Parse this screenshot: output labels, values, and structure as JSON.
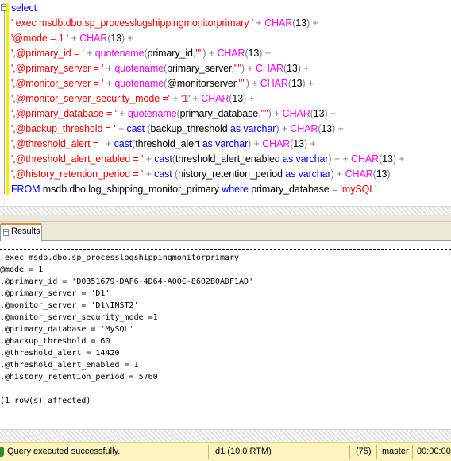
{
  "editor": {
    "lines": [
      {
        "tokens": [
          {
            "c": "kw",
            "t": "select"
          }
        ]
      },
      {
        "tokens": [
          {
            "c": "str",
            "t": "' exec msdb.dbo.sp_processlogshippingmonitorprimary '"
          },
          {
            "c": "op",
            "t": " + "
          },
          {
            "c": "fn",
            "t": "CHAR"
          },
          {
            "c": "op",
            "t": "("
          },
          {
            "c": "tx",
            "t": "13"
          },
          {
            "c": "op",
            "t": ") +"
          }
        ]
      },
      {
        "tokens": [
          {
            "c": "str",
            "t": "'@mode = 1 '"
          },
          {
            "c": "op",
            "t": " + "
          },
          {
            "c": "fn",
            "t": "CHAR"
          },
          {
            "c": "op",
            "t": "("
          },
          {
            "c": "tx",
            "t": "13"
          },
          {
            "c": "op",
            "t": ") +"
          }
        ]
      },
      {
        "tokens": [
          {
            "c": "str",
            "t": "',@primary_id = '"
          },
          {
            "c": "op",
            "t": " + "
          },
          {
            "c": "fn",
            "t": "quotename"
          },
          {
            "c": "op",
            "t": "("
          },
          {
            "c": "tx",
            "t": "primary_id"
          },
          {
            "c": "op",
            "t": ","
          },
          {
            "c": "str",
            "t": "''''"
          },
          {
            "c": "op",
            "t": ") + "
          },
          {
            "c": "fn",
            "t": "CHAR"
          },
          {
            "c": "op",
            "t": "("
          },
          {
            "c": "tx",
            "t": "13"
          },
          {
            "c": "op",
            "t": ") +"
          }
        ]
      },
      {
        "tokens": [
          {
            "c": "str",
            "t": "',@primary_server = '"
          },
          {
            "c": "op",
            "t": " + "
          },
          {
            "c": "fn",
            "t": "quotename"
          },
          {
            "c": "op",
            "t": "("
          },
          {
            "c": "tx",
            "t": "primary_server"
          },
          {
            "c": "op",
            "t": ","
          },
          {
            "c": "str",
            "t": "''''"
          },
          {
            "c": "op",
            "t": ") + "
          },
          {
            "c": "fn",
            "t": "CHAR"
          },
          {
            "c": "op",
            "t": "("
          },
          {
            "c": "tx",
            "t": "13"
          },
          {
            "c": "op",
            "t": ") +"
          }
        ]
      },
      {
        "tokens": [
          {
            "c": "str",
            "t": "',@monitor_server = '"
          },
          {
            "c": "op",
            "t": " + "
          },
          {
            "c": "fn",
            "t": "quotename"
          },
          {
            "c": "op",
            "t": "("
          },
          {
            "c": "tx",
            "t": "@monitorserver"
          },
          {
            "c": "op",
            "t": ","
          },
          {
            "c": "str",
            "t": "''''"
          },
          {
            "c": "op",
            "t": ") + "
          },
          {
            "c": "fn",
            "t": "CHAR"
          },
          {
            "c": "op",
            "t": "("
          },
          {
            "c": "tx",
            "t": "13"
          },
          {
            "c": "op",
            "t": ") +"
          }
        ]
      },
      {
        "tokens": [
          {
            "c": "str",
            "t": "',@monitor_server_security_mode ='"
          },
          {
            "c": "op",
            "t": " + "
          },
          {
            "c": "str",
            "t": "'1'"
          },
          {
            "c": "op",
            "t": " + "
          },
          {
            "c": "fn",
            "t": "CHAR"
          },
          {
            "c": "op",
            "t": "("
          },
          {
            "c": "tx",
            "t": "13"
          },
          {
            "c": "op",
            "t": ") +"
          }
        ]
      },
      {
        "tokens": [
          {
            "c": "str",
            "t": "',@primary_database = '"
          },
          {
            "c": "op",
            "t": " + "
          },
          {
            "c": "fn",
            "t": "quotename"
          },
          {
            "c": "op",
            "t": "("
          },
          {
            "c": "tx",
            "t": "primary_database"
          },
          {
            "c": "op",
            "t": ","
          },
          {
            "c": "str",
            "t": "''''"
          },
          {
            "c": "op",
            "t": ") + "
          },
          {
            "c": "fn",
            "t": "CHAR"
          },
          {
            "c": "op",
            "t": "("
          },
          {
            "c": "tx",
            "t": "13"
          },
          {
            "c": "op",
            "t": ") +"
          }
        ]
      },
      {
        "tokens": [
          {
            "c": "str",
            "t": "',@backup_threshold = '"
          },
          {
            "c": "op",
            "t": " + "
          },
          {
            "c": "kw",
            "t": "cast"
          },
          {
            "c": "op",
            "t": " ("
          },
          {
            "c": "tx",
            "t": "backup_threshold "
          },
          {
            "c": "kw",
            "t": "as varchar"
          },
          {
            "c": "op",
            "t": ") + "
          },
          {
            "c": "fn",
            "t": "CHAR"
          },
          {
            "c": "op",
            "t": "("
          },
          {
            "c": "tx",
            "t": "13"
          },
          {
            "c": "op",
            "t": ") +"
          }
        ]
      },
      {
        "tokens": [
          {
            "c": "str",
            "t": "',@threshold_alert = '"
          },
          {
            "c": "op",
            "t": " + "
          },
          {
            "c": "kw",
            "t": "cast"
          },
          {
            "c": "op",
            "t": "("
          },
          {
            "c": "tx",
            "t": "threshold_alert "
          },
          {
            "c": "kw",
            "t": "as varchar"
          },
          {
            "c": "op",
            "t": ") + "
          },
          {
            "c": "fn",
            "t": "CHAR"
          },
          {
            "c": "op",
            "t": "("
          },
          {
            "c": "tx",
            "t": "13"
          },
          {
            "c": "op",
            "t": ") +"
          }
        ]
      },
      {
        "tokens": [
          {
            "c": "str",
            "t": "',@threshold_alert_enabled = '"
          },
          {
            "c": "op",
            "t": " + "
          },
          {
            "c": "kw",
            "t": "cast"
          },
          {
            "c": "op",
            "t": "("
          },
          {
            "c": "tx",
            "t": "threshold_alert_enabled "
          },
          {
            "c": "kw",
            "t": "as varchar"
          },
          {
            "c": "op",
            "t": ") + + "
          },
          {
            "c": "fn",
            "t": "CHAR"
          },
          {
            "c": "op",
            "t": "("
          },
          {
            "c": "tx",
            "t": "13"
          },
          {
            "c": "op",
            "t": ") +"
          }
        ]
      },
      {
        "tokens": [
          {
            "c": "str",
            "t": "',@history_retention_period = '"
          },
          {
            "c": "op",
            "t": " + "
          },
          {
            "c": "kw",
            "t": "cast"
          },
          {
            "c": "op",
            "t": " ("
          },
          {
            "c": "tx",
            "t": "history_retention_period "
          },
          {
            "c": "kw",
            "t": "as varchar"
          },
          {
            "c": "op",
            "t": ") + "
          },
          {
            "c": "fn",
            "t": "CHAR"
          },
          {
            "c": "op",
            "t": "("
          },
          {
            "c": "tx",
            "t": "13"
          },
          {
            "c": "op",
            "t": ")"
          }
        ]
      },
      {
        "tokens": [
          {
            "c": "kw",
            "t": "FROM"
          },
          {
            "c": "tx",
            "t": " msdb.dbo.log_shipping_monitor_primary "
          },
          {
            "c": "kw",
            "t": "where"
          },
          {
            "c": "tx",
            "t": " primary_database "
          },
          {
            "c": "op",
            "t": "= "
          },
          {
            "c": "str",
            "t": "'mySQL'"
          }
        ]
      }
    ]
  },
  "tabs": {
    "results_label": "Results"
  },
  "results": {
    "lines": [
      " exec msdb.dbo.sp_processlogshippingmonitorprimary",
      "@mode = 1",
      ",@primary_id = 'D0351679-DAF6-4D64-A00C-8602B0ADF1AD'",
      ",@primary_server = 'D1'",
      ",@monitor_server = 'D1\\INST2'",
      ",@monitor_server_security_mode =1",
      ",@primary_database = 'MySQL'",
      ",@backup_threshold = 60",
      ",@threshold_alert = 14420",
      ",@threshold_alert_enabled = 1",
      ",@history_retention_period = 5760",
      "",
      "(1 row(s) affected)"
    ]
  },
  "status": {
    "message": "Query executed successfully.",
    "server": ".d1 (10.0 RTM)",
    "spid": "(75)",
    "database": "master",
    "elapsed": "00:00:00"
  },
  "colors": {
    "keyword": "#0000ff",
    "function": "#ff00ff",
    "string": "#ff0000",
    "operator": "#808080",
    "statusbar": "#fff4c0"
  }
}
